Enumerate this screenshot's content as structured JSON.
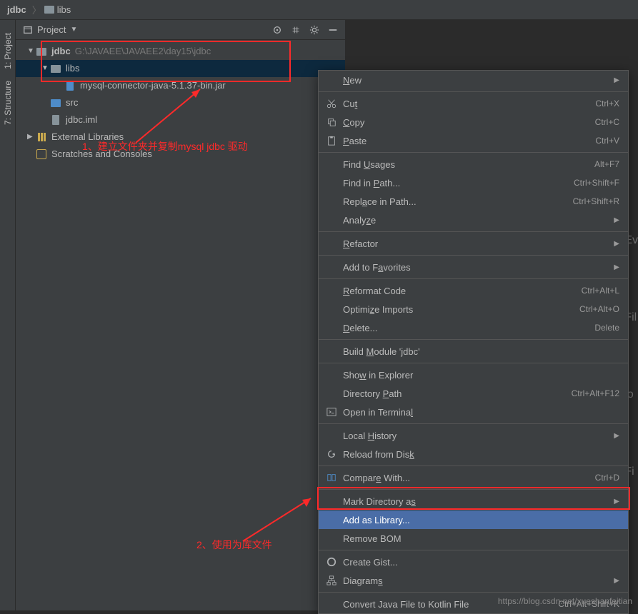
{
  "breadcrumb": {
    "root": "jdbc",
    "current": "libs"
  },
  "panel": {
    "title": "Project"
  },
  "tree": {
    "project_name": "jdbc",
    "project_path": "G:\\JAVAEE\\JAVAEE2\\day15\\jdbc",
    "libs": "libs",
    "jar": "mysql-connector-java-5.1.37-bin.jar",
    "src": "src",
    "iml": "jdbc.iml",
    "external": "External Libraries",
    "scratches": "Scratches and Consoles"
  },
  "sidebar": {
    "project": "1: Project",
    "structure": "7: Structure"
  },
  "annotations": {
    "a1": "1、建立文件夹并复制mysql jdbc 驱动",
    "a2": "2、使用为库文件"
  },
  "editor_hints": {
    "h1": "Ev",
    "h2": "Fil",
    "h3": "io",
    "h4": "Fi"
  },
  "context_menu": [
    {
      "type": "item",
      "label_pre": "",
      "label_u": "N",
      "label_post": "ew",
      "shortcut": "",
      "submenu": true,
      "icon": ""
    },
    {
      "type": "sep"
    },
    {
      "type": "item",
      "label_pre": "Cu",
      "label_u": "t",
      "label_post": "",
      "shortcut": "Ctrl+X",
      "icon": "cut"
    },
    {
      "type": "item",
      "label_pre": "",
      "label_u": "C",
      "label_post": "opy",
      "shortcut": "Ctrl+C",
      "icon": "copy"
    },
    {
      "type": "item",
      "label_pre": "",
      "label_u": "P",
      "label_post": "aste",
      "shortcut": "Ctrl+V",
      "icon": "paste"
    },
    {
      "type": "sep"
    },
    {
      "type": "item",
      "label_pre": "Find ",
      "label_u": "U",
      "label_post": "sages",
      "shortcut": "Alt+F7",
      "icon": ""
    },
    {
      "type": "item",
      "label_pre": "Find in ",
      "label_u": "P",
      "label_post": "ath...",
      "shortcut": "Ctrl+Shift+F",
      "icon": ""
    },
    {
      "type": "item",
      "label_pre": "Repl",
      "label_u": "a",
      "label_post": "ce in Path...",
      "shortcut": "Ctrl+Shift+R",
      "icon": ""
    },
    {
      "type": "item",
      "label_pre": "Analy",
      "label_u": "z",
      "label_post": "e",
      "shortcut": "",
      "submenu": true,
      "icon": ""
    },
    {
      "type": "sep"
    },
    {
      "type": "item",
      "label_pre": "",
      "label_u": "R",
      "label_post": "efactor",
      "shortcut": "",
      "submenu": true,
      "icon": ""
    },
    {
      "type": "sep"
    },
    {
      "type": "item",
      "label_pre": "Add to F",
      "label_u": "a",
      "label_post": "vorites",
      "shortcut": "",
      "submenu": true,
      "icon": ""
    },
    {
      "type": "sep"
    },
    {
      "type": "item",
      "label_pre": "",
      "label_u": "R",
      "label_post": "eformat Code",
      "shortcut": "Ctrl+Alt+L",
      "icon": ""
    },
    {
      "type": "item",
      "label_pre": "Optimi",
      "label_u": "z",
      "label_post": "e Imports",
      "shortcut": "Ctrl+Alt+O",
      "icon": ""
    },
    {
      "type": "item",
      "label_pre": "",
      "label_u": "D",
      "label_post": "elete...",
      "shortcut": "Delete",
      "icon": ""
    },
    {
      "type": "sep"
    },
    {
      "type": "item",
      "label_pre": "Build ",
      "label_u": "M",
      "label_post": "odule 'jdbc'",
      "shortcut": "",
      "icon": ""
    },
    {
      "type": "sep"
    },
    {
      "type": "item",
      "label_pre": "Sho",
      "label_u": "w",
      "label_post": " in Explorer",
      "shortcut": "",
      "icon": ""
    },
    {
      "type": "item",
      "label_pre": "Directory ",
      "label_u": "P",
      "label_post": "ath",
      "shortcut": "Ctrl+Alt+F12",
      "icon": ""
    },
    {
      "type": "item",
      "label_pre": "Open in Termina",
      "label_u": "l",
      "label_post": "",
      "shortcut": "",
      "icon": "terminal"
    },
    {
      "type": "sep"
    },
    {
      "type": "item",
      "label_pre": "Local ",
      "label_u": "H",
      "label_post": "istory",
      "shortcut": "",
      "submenu": true,
      "icon": ""
    },
    {
      "type": "item",
      "label_pre": "Reload from Dis",
      "label_u": "k",
      "label_post": "",
      "shortcut": "",
      "icon": "reload"
    },
    {
      "type": "sep"
    },
    {
      "type": "item",
      "label_pre": "Compar",
      "label_u": "e",
      "label_post": " With...",
      "shortcut": "Ctrl+D",
      "icon": "compare"
    },
    {
      "type": "sep"
    },
    {
      "type": "item",
      "label_pre": "Mark Directory a",
      "label_u": "s",
      "label_post": "",
      "shortcut": "",
      "submenu": true,
      "icon": ""
    },
    {
      "type": "item",
      "label_pre": "Add as Library...",
      "label_u": "",
      "label_post": "",
      "shortcut": "",
      "icon": "",
      "selected": true
    },
    {
      "type": "item",
      "label_pre": "Remove BOM",
      "label_u": "",
      "label_post": "",
      "shortcut": "",
      "icon": ""
    },
    {
      "type": "sep"
    },
    {
      "type": "item",
      "label_pre": "Create Gist...",
      "label_u": "",
      "label_post": "",
      "shortcut": "",
      "icon": "github"
    },
    {
      "type": "item",
      "label_pre": "Diagram",
      "label_u": "s",
      "label_post": "",
      "shortcut": "",
      "submenu": true,
      "icon": "diagram"
    },
    {
      "type": "sep"
    },
    {
      "type": "item",
      "label_pre": "Convert Java File to Kotlin File",
      "label_u": "",
      "label_post": "",
      "shortcut": "Ctrl+Alt+Shift+K",
      "icon": ""
    }
  ],
  "watermark": "https://blog.csdn.net/xueshanfeitian"
}
